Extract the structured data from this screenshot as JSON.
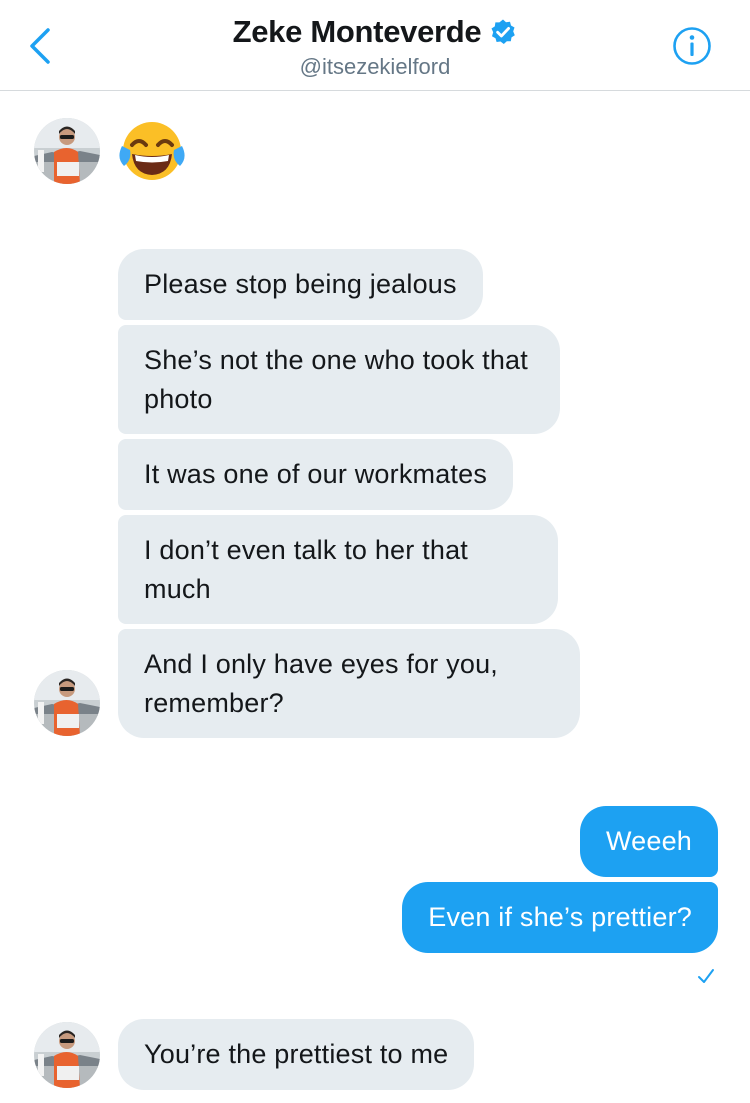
{
  "header": {
    "name": "Zeke Monteverde",
    "handle": "@itsezekielford"
  },
  "messages": {
    "m1": "Please stop being jealous",
    "m2": "She’s not the one who took that photo",
    "m3": "It was one of our workmates",
    "m4": "I don’t even talk to her that much",
    "m5": "And I only have eyes for you, remember?",
    "m6": "Weeeh",
    "m7": "Even if she’s prettier?",
    "m8": "You’re the prettiest to me"
  },
  "colors": {
    "accent": "#1da1f2",
    "incoming_bubble": "#e6ecf0",
    "handle_gray": "#657786"
  },
  "icons": {
    "back": "chevron-left-icon",
    "verified": "verified-badge-icon",
    "info": "info-icon",
    "emoji": "face-with-tears-of-joy",
    "read": "checkmark-icon"
  }
}
